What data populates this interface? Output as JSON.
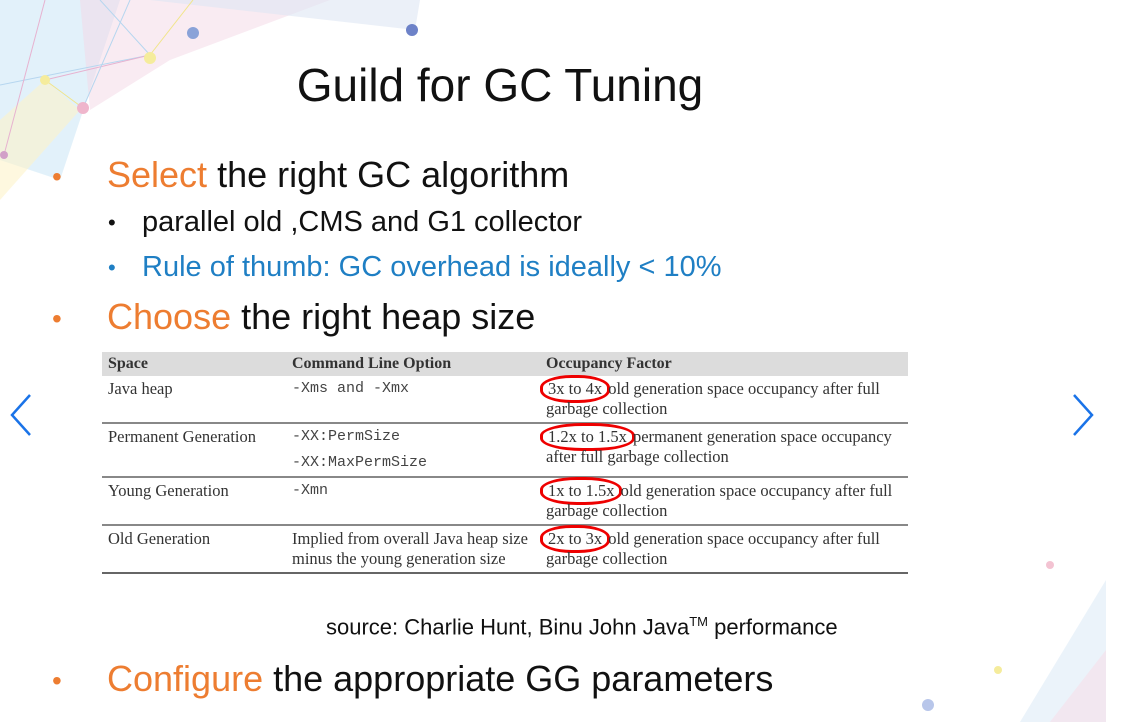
{
  "slide": {
    "title": "Guild for GC Tuning",
    "bullets": [
      {
        "accent": "Select",
        "rest": " the right GC algorithm"
      },
      {
        "accent": "Choose",
        "rest": " the right heap size"
      },
      {
        "accent": "Configure",
        "rest": " the appropriate GG parameters"
      }
    ],
    "sub_bullets": [
      {
        "text": "parallel old ,CMS and G1 collector"
      },
      {
        "text": "Rule of thumb: GC overhead is ideally < 10%"
      }
    ],
    "table": {
      "headers": [
        "Space",
        "Command Line Option",
        "Occupancy Factor"
      ],
      "rows": [
        {
          "space": "Java heap",
          "option": "-Xms and -Xmx",
          "option2": "",
          "factor": "3x to 4x",
          "factor_rest": " old generation space occupancy after full garbage collection"
        },
        {
          "space": "Permanent Generation",
          "option": "-XX:PermSize",
          "option2": "-XX:MaxPermSize",
          "factor": "1.2x to 1.5x",
          "factor_rest": " permanent generation space occupancy after full garbage collection"
        },
        {
          "space": "Young Generation",
          "option": "-Xmn",
          "option2": "",
          "factor": "1x to 1.5x",
          "factor_rest": " old generation space occupancy after full garbage collection"
        },
        {
          "space": "Old Generation",
          "option": "Implied from overall Java heap size minus the young generation size",
          "option2": "",
          "factor": "2x to 3x",
          "factor_rest": " old generation space occupancy after full garbage collection"
        }
      ]
    },
    "source": "source: Charlie Hunt, Binu John  Java",
    "source_sup": "TM",
    "source_end": " performance"
  },
  "colors": {
    "accent": "#ed7d31",
    "blue": "#1f7fc4",
    "nav": "#1a73e8",
    "annotation": "#e00000"
  },
  "nav": {
    "prev_icon": "chevron-left-icon",
    "next_icon": "chevron-right-icon"
  }
}
